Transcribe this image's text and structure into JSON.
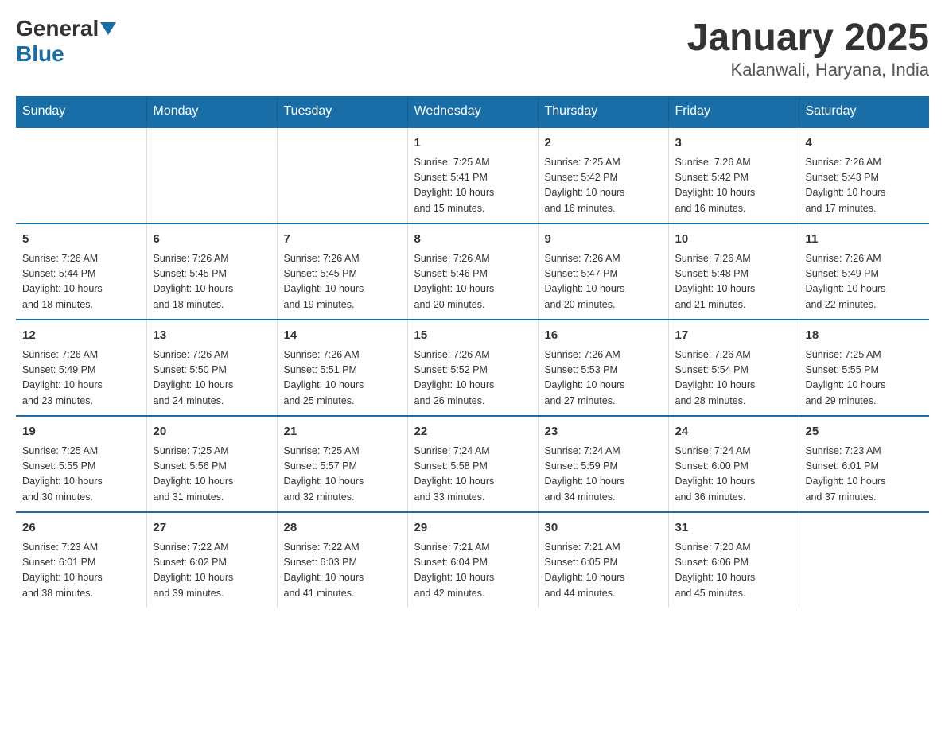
{
  "header": {
    "logo_general": "General",
    "logo_blue": "Blue",
    "title": "January 2025",
    "subtitle": "Kalanwali, Haryana, India"
  },
  "days_of_week": [
    "Sunday",
    "Monday",
    "Tuesday",
    "Wednesday",
    "Thursday",
    "Friday",
    "Saturday"
  ],
  "weeks": [
    [
      {
        "num": "",
        "info": ""
      },
      {
        "num": "",
        "info": ""
      },
      {
        "num": "",
        "info": ""
      },
      {
        "num": "1",
        "info": "Sunrise: 7:25 AM\nSunset: 5:41 PM\nDaylight: 10 hours\nand 15 minutes."
      },
      {
        "num": "2",
        "info": "Sunrise: 7:25 AM\nSunset: 5:42 PM\nDaylight: 10 hours\nand 16 minutes."
      },
      {
        "num": "3",
        "info": "Sunrise: 7:26 AM\nSunset: 5:42 PM\nDaylight: 10 hours\nand 16 minutes."
      },
      {
        "num": "4",
        "info": "Sunrise: 7:26 AM\nSunset: 5:43 PM\nDaylight: 10 hours\nand 17 minutes."
      }
    ],
    [
      {
        "num": "5",
        "info": "Sunrise: 7:26 AM\nSunset: 5:44 PM\nDaylight: 10 hours\nand 18 minutes."
      },
      {
        "num": "6",
        "info": "Sunrise: 7:26 AM\nSunset: 5:45 PM\nDaylight: 10 hours\nand 18 minutes."
      },
      {
        "num": "7",
        "info": "Sunrise: 7:26 AM\nSunset: 5:45 PM\nDaylight: 10 hours\nand 19 minutes."
      },
      {
        "num": "8",
        "info": "Sunrise: 7:26 AM\nSunset: 5:46 PM\nDaylight: 10 hours\nand 20 minutes."
      },
      {
        "num": "9",
        "info": "Sunrise: 7:26 AM\nSunset: 5:47 PM\nDaylight: 10 hours\nand 20 minutes."
      },
      {
        "num": "10",
        "info": "Sunrise: 7:26 AM\nSunset: 5:48 PM\nDaylight: 10 hours\nand 21 minutes."
      },
      {
        "num": "11",
        "info": "Sunrise: 7:26 AM\nSunset: 5:49 PM\nDaylight: 10 hours\nand 22 minutes."
      }
    ],
    [
      {
        "num": "12",
        "info": "Sunrise: 7:26 AM\nSunset: 5:49 PM\nDaylight: 10 hours\nand 23 minutes."
      },
      {
        "num": "13",
        "info": "Sunrise: 7:26 AM\nSunset: 5:50 PM\nDaylight: 10 hours\nand 24 minutes."
      },
      {
        "num": "14",
        "info": "Sunrise: 7:26 AM\nSunset: 5:51 PM\nDaylight: 10 hours\nand 25 minutes."
      },
      {
        "num": "15",
        "info": "Sunrise: 7:26 AM\nSunset: 5:52 PM\nDaylight: 10 hours\nand 26 minutes."
      },
      {
        "num": "16",
        "info": "Sunrise: 7:26 AM\nSunset: 5:53 PM\nDaylight: 10 hours\nand 27 minutes."
      },
      {
        "num": "17",
        "info": "Sunrise: 7:26 AM\nSunset: 5:54 PM\nDaylight: 10 hours\nand 28 minutes."
      },
      {
        "num": "18",
        "info": "Sunrise: 7:25 AM\nSunset: 5:55 PM\nDaylight: 10 hours\nand 29 minutes."
      }
    ],
    [
      {
        "num": "19",
        "info": "Sunrise: 7:25 AM\nSunset: 5:55 PM\nDaylight: 10 hours\nand 30 minutes."
      },
      {
        "num": "20",
        "info": "Sunrise: 7:25 AM\nSunset: 5:56 PM\nDaylight: 10 hours\nand 31 minutes."
      },
      {
        "num": "21",
        "info": "Sunrise: 7:25 AM\nSunset: 5:57 PM\nDaylight: 10 hours\nand 32 minutes."
      },
      {
        "num": "22",
        "info": "Sunrise: 7:24 AM\nSunset: 5:58 PM\nDaylight: 10 hours\nand 33 minutes."
      },
      {
        "num": "23",
        "info": "Sunrise: 7:24 AM\nSunset: 5:59 PM\nDaylight: 10 hours\nand 34 minutes."
      },
      {
        "num": "24",
        "info": "Sunrise: 7:24 AM\nSunset: 6:00 PM\nDaylight: 10 hours\nand 36 minutes."
      },
      {
        "num": "25",
        "info": "Sunrise: 7:23 AM\nSunset: 6:01 PM\nDaylight: 10 hours\nand 37 minutes."
      }
    ],
    [
      {
        "num": "26",
        "info": "Sunrise: 7:23 AM\nSunset: 6:01 PM\nDaylight: 10 hours\nand 38 minutes."
      },
      {
        "num": "27",
        "info": "Sunrise: 7:22 AM\nSunset: 6:02 PM\nDaylight: 10 hours\nand 39 minutes."
      },
      {
        "num": "28",
        "info": "Sunrise: 7:22 AM\nSunset: 6:03 PM\nDaylight: 10 hours\nand 41 minutes."
      },
      {
        "num": "29",
        "info": "Sunrise: 7:21 AM\nSunset: 6:04 PM\nDaylight: 10 hours\nand 42 minutes."
      },
      {
        "num": "30",
        "info": "Sunrise: 7:21 AM\nSunset: 6:05 PM\nDaylight: 10 hours\nand 44 minutes."
      },
      {
        "num": "31",
        "info": "Sunrise: 7:20 AM\nSunset: 6:06 PM\nDaylight: 10 hours\nand 45 minutes."
      },
      {
        "num": "",
        "info": ""
      }
    ]
  ]
}
